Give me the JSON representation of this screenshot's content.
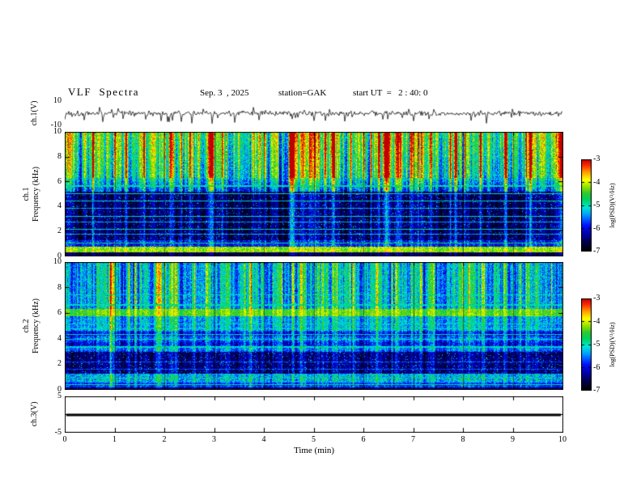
{
  "header": {
    "title": "VLF  Spectra",
    "date": "Sep. 3  , 2025",
    "station": "station=GAK",
    "start_ut": "start UT  =   2 : 40: 0"
  },
  "xaxis": {
    "label": "Time (min)",
    "min": 0,
    "max": 10,
    "tick_labels": [
      "0",
      "1",
      "2",
      "3",
      "4",
      "5",
      "6",
      "7",
      "8",
      "9",
      "10"
    ]
  },
  "colorbars": [
    {
      "label": "log(PSD)(V²/Hz)",
      "tick_labels": [
        "-3",
        "-4",
        "-5",
        "-6",
        "-7"
      ],
      "zmin": -7,
      "zmax": -3
    },
    {
      "label": "log(PSD)(V²/Hz)",
      "tick_labels": [
        "-3",
        "-4",
        "-5",
        "-6",
        "-7"
      ],
      "zmin": -7,
      "zmax": -3
    }
  ],
  "colors": {
    "background": "#ffffff",
    "frame": "#000000",
    "trace": "#000000",
    "grid_overlay": "rgba(0,0,60,0.5)",
    "colormap_stops": [
      [
        0.0,
        "#000000"
      ],
      [
        0.1,
        "#00004d"
      ],
      [
        0.18,
        "#0000a0"
      ],
      [
        0.28,
        "#0010ff"
      ],
      [
        0.4,
        "#00a0ff"
      ],
      [
        0.48,
        "#00e8d0"
      ],
      [
        0.56,
        "#00d060"
      ],
      [
        0.63,
        "#30c830"
      ],
      [
        0.7,
        "#90e000"
      ],
      [
        0.78,
        "#ffff00"
      ],
      [
        0.86,
        "#ffa000"
      ],
      [
        0.93,
        "#ff3000"
      ],
      [
        1.0,
        "#c00000"
      ]
    ]
  },
  "chart_data": [
    {
      "type": "line",
      "name": "ch1-waveform",
      "ylabel": "ch.1(V)",
      "ymin": -10,
      "ymax": 10,
      "ytick_labels": [
        "10",
        "-10"
      ],
      "description": "broadband noise around 0 V with impulsive spikes, mostly negative, to about -9 V",
      "noise_amplitude_v": 1.0,
      "spike_count": 50,
      "seed": 1337
    },
    {
      "type": "heatmap",
      "name": "ch1-spectrogram",
      "ylabel_lines": [
        "ch.1",
        "Frequency (kHz)"
      ],
      "ymin": 0,
      "ymax": 10,
      "ytick_labels": [
        "10",
        "8",
        "6",
        "4",
        "2",
        "0"
      ],
      "zlabel": "log(PSD)(V²/Hz)",
      "zmin": -7,
      "zmax": -3,
      "seed": 90131,
      "streak_count": 70,
      "streak_amp_min": 0.18,
      "streak_amp_max": 0.48,
      "bands": [
        {
          "f": [
            0,
            0.3
          ],
          "base": 0.1,
          "noise": 0.07,
          "streak_w": 0.2
        },
        {
          "f": [
            0.3,
            0.8
          ],
          "base": 0.7,
          "noise": 0.09,
          "streak_w": 0.15
        },
        {
          "f": [
            0.8,
            1.3
          ],
          "base": 0.27,
          "noise": 0.12,
          "streak_w": 0.3
        },
        {
          "f": [
            1.3,
            5.2
          ],
          "base": 0.12,
          "noise": 0.09,
          "streak_w": 0.4,
          "speckle": 0.05,
          "speckle_amp": 0.27
        },
        {
          "f": [
            5.2,
            6.3
          ],
          "base": 0.3,
          "noise": 0.13,
          "streak_w": 0.7,
          "slope": 0.16
        },
        {
          "f": [
            6.3,
            10
          ],
          "base": 0.52,
          "noise": 0.12,
          "streak_w": 1.0,
          "slope": 0.03
        }
      ],
      "hlines": [
        {
          "f": 1.05,
          "v": 0.55
        },
        {
          "f": 1.8,
          "v": 0.42
        },
        {
          "f": 2.15,
          "v": 0.48
        },
        {
          "f": 2.75,
          "v": 0.42
        },
        {
          "f": 3.2,
          "v": 0.47
        },
        {
          "f": 3.85,
          "v": 0.43
        },
        {
          "f": 4.45,
          "v": 0.47
        },
        {
          "f": 5.05,
          "v": 0.5
        },
        {
          "f": 5.65,
          "v": 0.52
        }
      ],
      "vlines": [
        {
          "x": 0.055,
          "amp": 0.3,
          "w": 2
        },
        {
          "x": 0.2,
          "amp": 0.28,
          "w": 2
        },
        {
          "x": 0.315,
          "amp": 0.3,
          "w": 2
        },
        {
          "x": 0.545,
          "amp": 0.3,
          "w": 2
        },
        {
          "x": 0.8,
          "amp": 0.32,
          "w": 2
        },
        {
          "x": 0.925,
          "amp": 0.3,
          "w": 2
        }
      ]
    },
    {
      "type": "heatmap",
      "name": "ch2-spectrogram",
      "ylabel_lines": [
        "ch.2",
        "Frequency (kHz)"
      ],
      "ymin": 0,
      "ymax": 10,
      "ytick_labels": [
        "10",
        "8",
        "6",
        "4",
        "2",
        "0"
      ],
      "zlabel": "log(PSD)(V²/Hz)",
      "zmin": -7,
      "zmax": -3,
      "seed": 55207,
      "streak_count": 60,
      "streak_amp_min": 0.15,
      "streak_amp_max": 0.4,
      "bands": [
        {
          "f": [
            0,
            0.2
          ],
          "base": 0.14,
          "noise": 0.07,
          "streak_w": 0.2
        },
        {
          "f": [
            0.2,
            0.6
          ],
          "base": 0.3,
          "noise": 0.1,
          "streak_w": 0.25
        },
        {
          "f": [
            0.6,
            1.25
          ],
          "base": 0.42,
          "noise": 0.12,
          "streak_w": 0.3
        },
        {
          "f": [
            1.25,
            3.0
          ],
          "base": 0.14,
          "noise": 0.09,
          "streak_w": 0.35,
          "speckle": 0.06,
          "speckle_amp": 0.26
        },
        {
          "f": [
            3.0,
            4.6
          ],
          "base": 0.31,
          "noise": 0.11,
          "streak_w": 0.45,
          "stripe_period": 0.8,
          "stripe_amp": 0.06
        },
        {
          "f": [
            4.6,
            5.75
          ],
          "base": 0.42,
          "noise": 0.1,
          "streak_w": 0.5
        },
        {
          "f": [
            5.75,
            6.35
          ],
          "base": 0.66,
          "noise": 0.07,
          "streak_w": 0.3
        },
        {
          "f": [
            6.35,
            10
          ],
          "base": 0.44,
          "noise": 0.11,
          "streak_w": 0.8
        }
      ],
      "hlines": [
        {
          "f": 0.4,
          "v": 0.52
        },
        {
          "f": 0.9,
          "v": 0.55
        },
        {
          "f": 1.6,
          "v": 0.33
        },
        {
          "f": 2.2,
          "v": 0.33
        },
        {
          "f": 3.35,
          "v": 0.48
        },
        {
          "f": 3.95,
          "v": 0.48
        },
        {
          "f": 4.35,
          "v": 0.5
        },
        {
          "f": 4.8,
          "v": 0.48
        },
        {
          "f": 5.15,
          "v": 0.5
        },
        {
          "f": 6.65,
          "v": 0.5
        },
        {
          "f": 7.45,
          "v": 0.48
        }
      ],
      "vlines": [
        {
          "x": 0.912,
          "amp": 0.42,
          "w": 2
        },
        {
          "x": 0.64,
          "amp": 0.25,
          "w": 1
        },
        {
          "x": 0.435,
          "amp": 0.28,
          "w": 1
        },
        {
          "x": 0.33,
          "amp": 0.26,
          "w": 1
        },
        {
          "x": 0.135,
          "amp": 0.25,
          "w": 1
        },
        {
          "x": 0.975,
          "amp": 0.3,
          "w": 1
        }
      ]
    },
    {
      "type": "line",
      "name": "ch3-waveform",
      "ylabel": "ch.3(V)",
      "ymin": -5,
      "ymax": 5,
      "ytick_labels": [
        "5",
        "-5"
      ],
      "description": "flat saturated trace at 0 V (thick black line)",
      "flat_value_v": 0,
      "seed": 7
    }
  ]
}
